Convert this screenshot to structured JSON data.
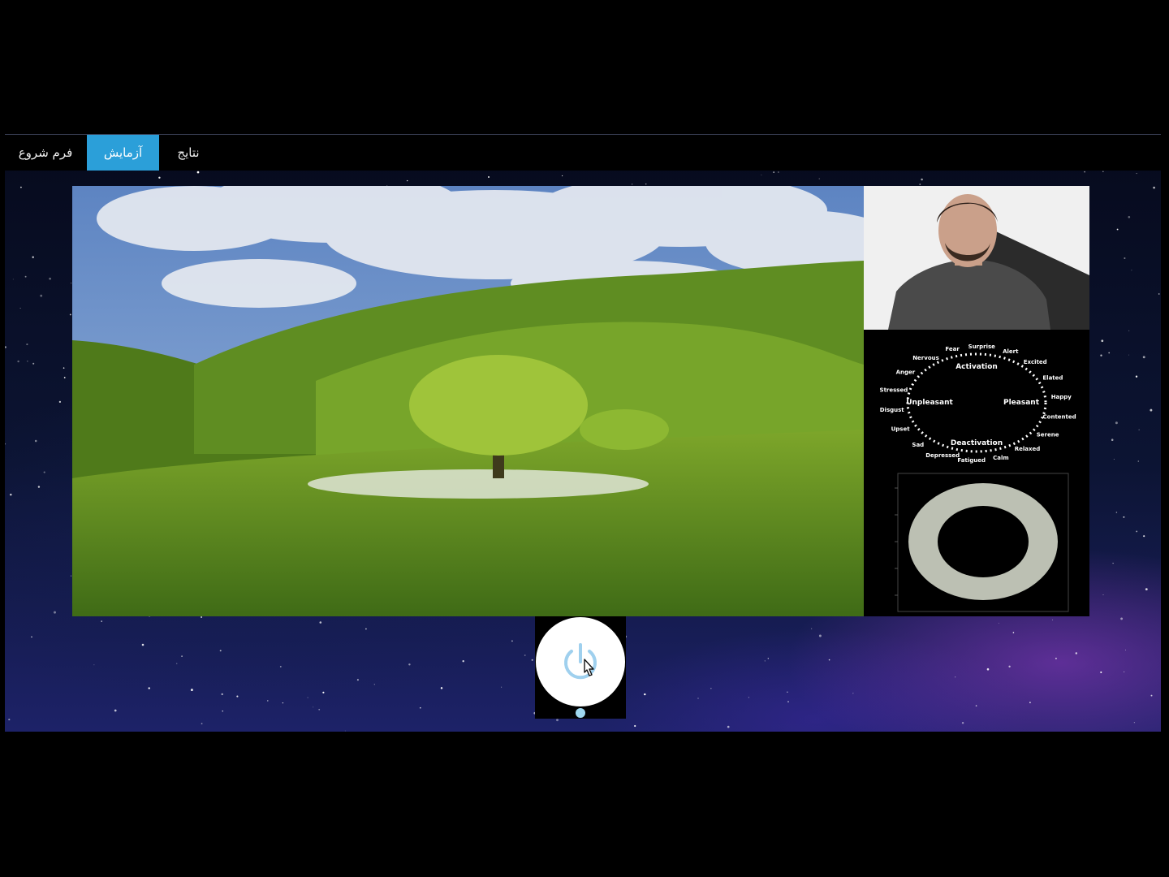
{
  "nav": {
    "tabs": [
      {
        "label": "فرم شروع",
        "active": false
      },
      {
        "label": "آزمایش",
        "active": true
      },
      {
        "label": "نتایج",
        "active": false
      }
    ],
    "active_color": "#2b9fd9"
  },
  "stimulus": {
    "icon": "landscape-image"
  },
  "webcam": {
    "icon": "person-video"
  },
  "circumplex": {
    "axes": {
      "top": "Activation",
      "bottom": "Deactivation",
      "left": "Unpleasant",
      "right": "Pleasant"
    },
    "emotions": [
      "Surprise",
      "Alert",
      "Excited",
      "Elated",
      "Happy",
      "Contented",
      "Serene",
      "Relaxed",
      "Calm",
      "Fatigued",
      "Depressed",
      "Sad",
      "Upset",
      "Disgust",
      "Stressed",
      "Anger",
      "Nervous",
      "Fear"
    ]
  },
  "control": {
    "icon": "power-icon"
  }
}
